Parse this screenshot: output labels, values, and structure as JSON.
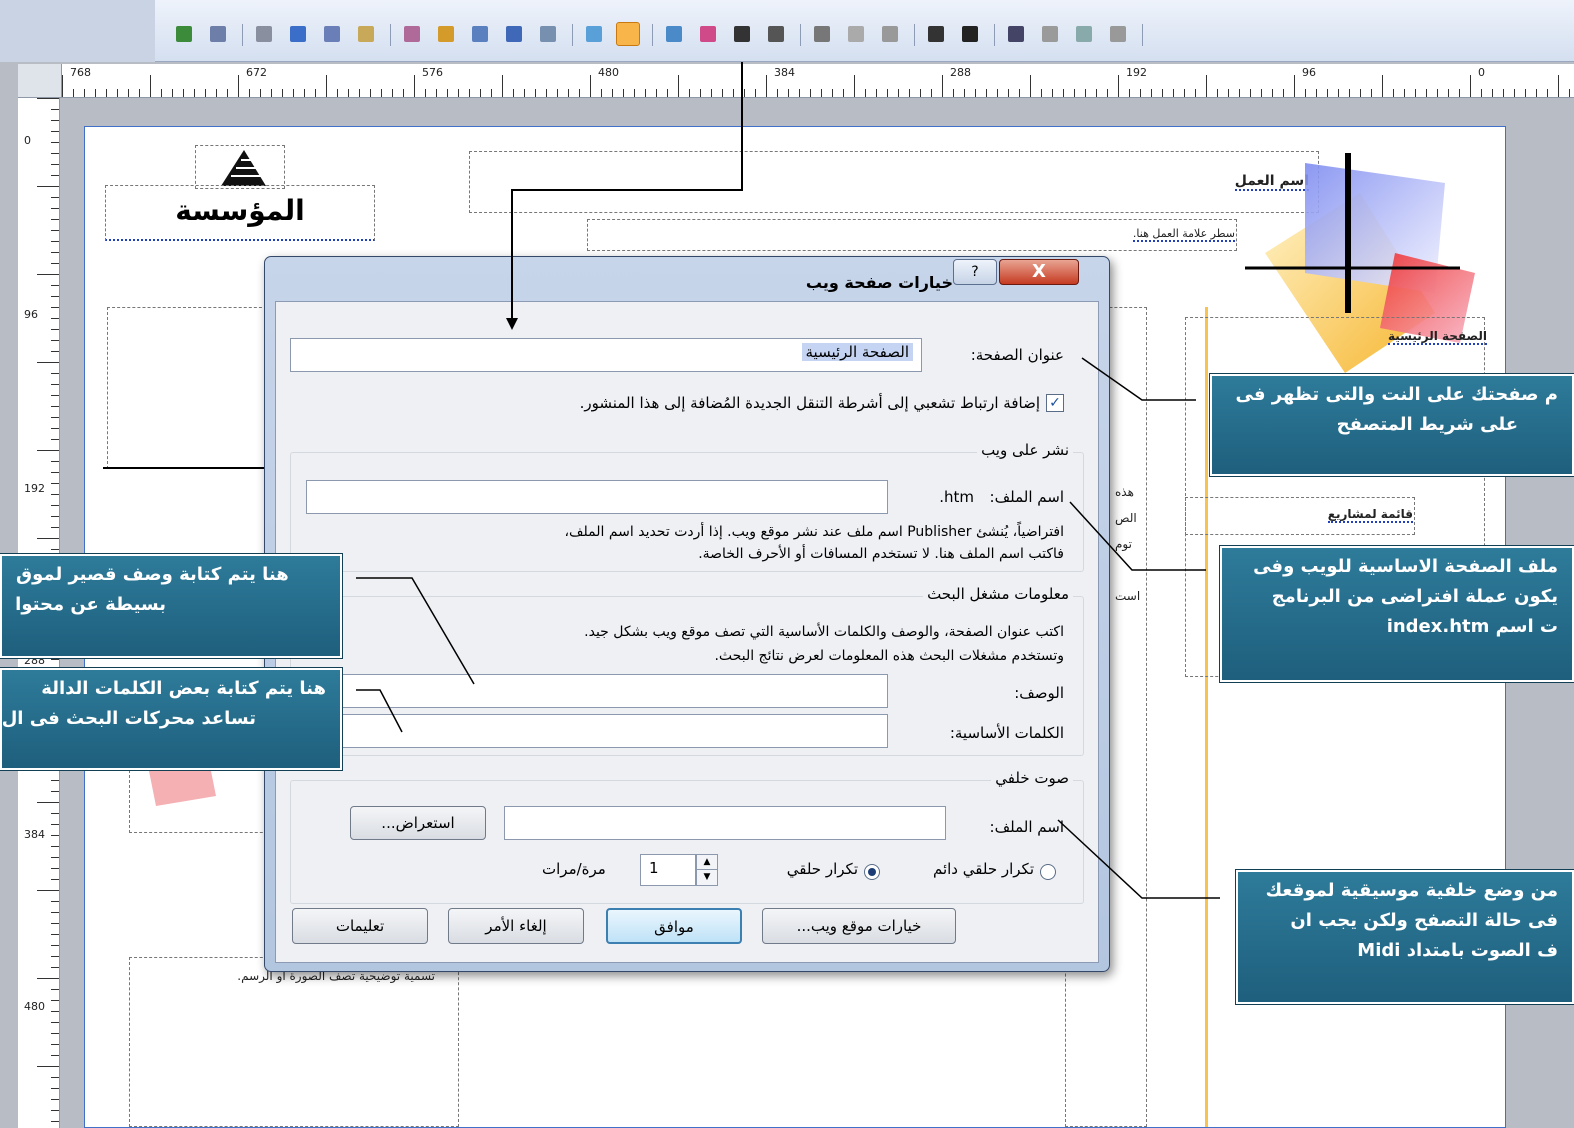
{
  "toolbar": {
    "buttons": [
      "globe-icon",
      "preview-icon",
      "users-icon",
      "web-icon",
      "document-icon",
      "page-icon",
      "tools-icon",
      "web-options-icon",
      "form-icon",
      "pen-icon",
      "insert-icon",
      "group-icon",
      "web-page-options-icon",
      "picture-icon",
      "color-icon",
      "layout-icon",
      "bring-forward-icon",
      "send-backward-icon",
      "rotate-icon",
      "flip-icon",
      "align-icon",
      "line-style-icon",
      "crop-icon",
      "fill-icon",
      "pencil-icon",
      "highlight-icon"
    ]
  },
  "ruler": {
    "h_labels": [
      "768",
      "672",
      "576",
      "480",
      "384",
      "288",
      "192",
      "96",
      "0"
    ],
    "v_labels": [
      "0",
      "96",
      "192",
      "288",
      "384",
      "480"
    ]
  },
  "page": {
    "company_label": "المؤسسة",
    "business_name": "اسم العمل",
    "tagline": "سطر علامة العمل هنا.",
    "nav_home": "الصفحة الرئيسية",
    "nav_projects": "قائمة لمشاريع",
    "side_text": [
      "هذه",
      "الص",
      "توم",
      "است"
    ],
    "caption_text": "تسمية توضيحية تصف الصورة أو الرسم."
  },
  "dialog": {
    "title": "خيارات صفحة ويب",
    "help": "?",
    "close": "X",
    "page_title_label": "عنوان الصفحة:",
    "page_title_value": "الصفحة الرئيسية",
    "add_hyperlink_label": "إضافة ارتباط تشعبي إلى أشرطة التنقل الجديدة المُضافة إلى هذا المنشور.",
    "add_hyperlink_checked": "✓",
    "publish_group": "نشر على ويب",
    "file_name_label": "اسم الملف:",
    "file_ext": "htm.",
    "publish_help_1": "افتراضياً، يُنشئ Publisher اسم ملف عند نشر موقع ويب. إذا أردت تحديد اسم الملف،",
    "publish_help_2": "فاكتب اسم الملف هنا. لا تستخدم المسافات أو الأحرف الخاصة.",
    "search_group": "معلومات مشغل البحث",
    "search_help_1": "اكتب عنوان الصفحة، والوصف والكلمات الأساسية التي تصف موقع ويب بشكل جيد.",
    "search_help_2": "وتستخدم مشغلات البحث هذه المعلومات لعرض نتائج البحث.",
    "description_label": "الوصف:",
    "keywords_label": "الكلمات الأساسية:",
    "sound_group": "صوت خلفي",
    "sound_file_label": "اسم الملف:",
    "browse_button": "استعراض...",
    "loop_forever": "تكرار حلقي دائم",
    "loop": "تكرار حلقي",
    "loop_count": "1",
    "times_label": "مرة/مرات",
    "site_options_button": "خيارات موقع ويب...",
    "ok_button": "موافق",
    "cancel_button": "إلغاء الأمر",
    "help_button": "تعليمات"
  },
  "callouts": {
    "right_1_line1": "م صفحتك على النت والتى تظهر فى",
    "right_1_line2": "على شريط المتصفح",
    "right_2_line1": "ملف الصفحة الاساسية للويب وفى",
    "right_2_line2": "يكون عملة افتراضى من البرنامج",
    "right_2_line3": "ت اسم index.htm",
    "right_3_line1": "من وضع خلفية موسيقية لموقعك",
    "right_3_line2": "فى حالة التصفح ولكن يجب ان",
    "right_3_line3": "ف الصوت بامتداد Midi",
    "left_1_line1": "هنا يتم كتابة وصف قصير لموق",
    "left_1_line2": "بسيطة عن محتوا",
    "left_2_line1": "هنا يتم كتابة بعض الكلمات الدالة",
    "left_2_line2": "تساعد محركات البحث فى ال"
  },
  "colors": {
    "callout_bg": "#22708f",
    "accent_orange": "#f7b54a",
    "page_border": "#4070c8"
  }
}
